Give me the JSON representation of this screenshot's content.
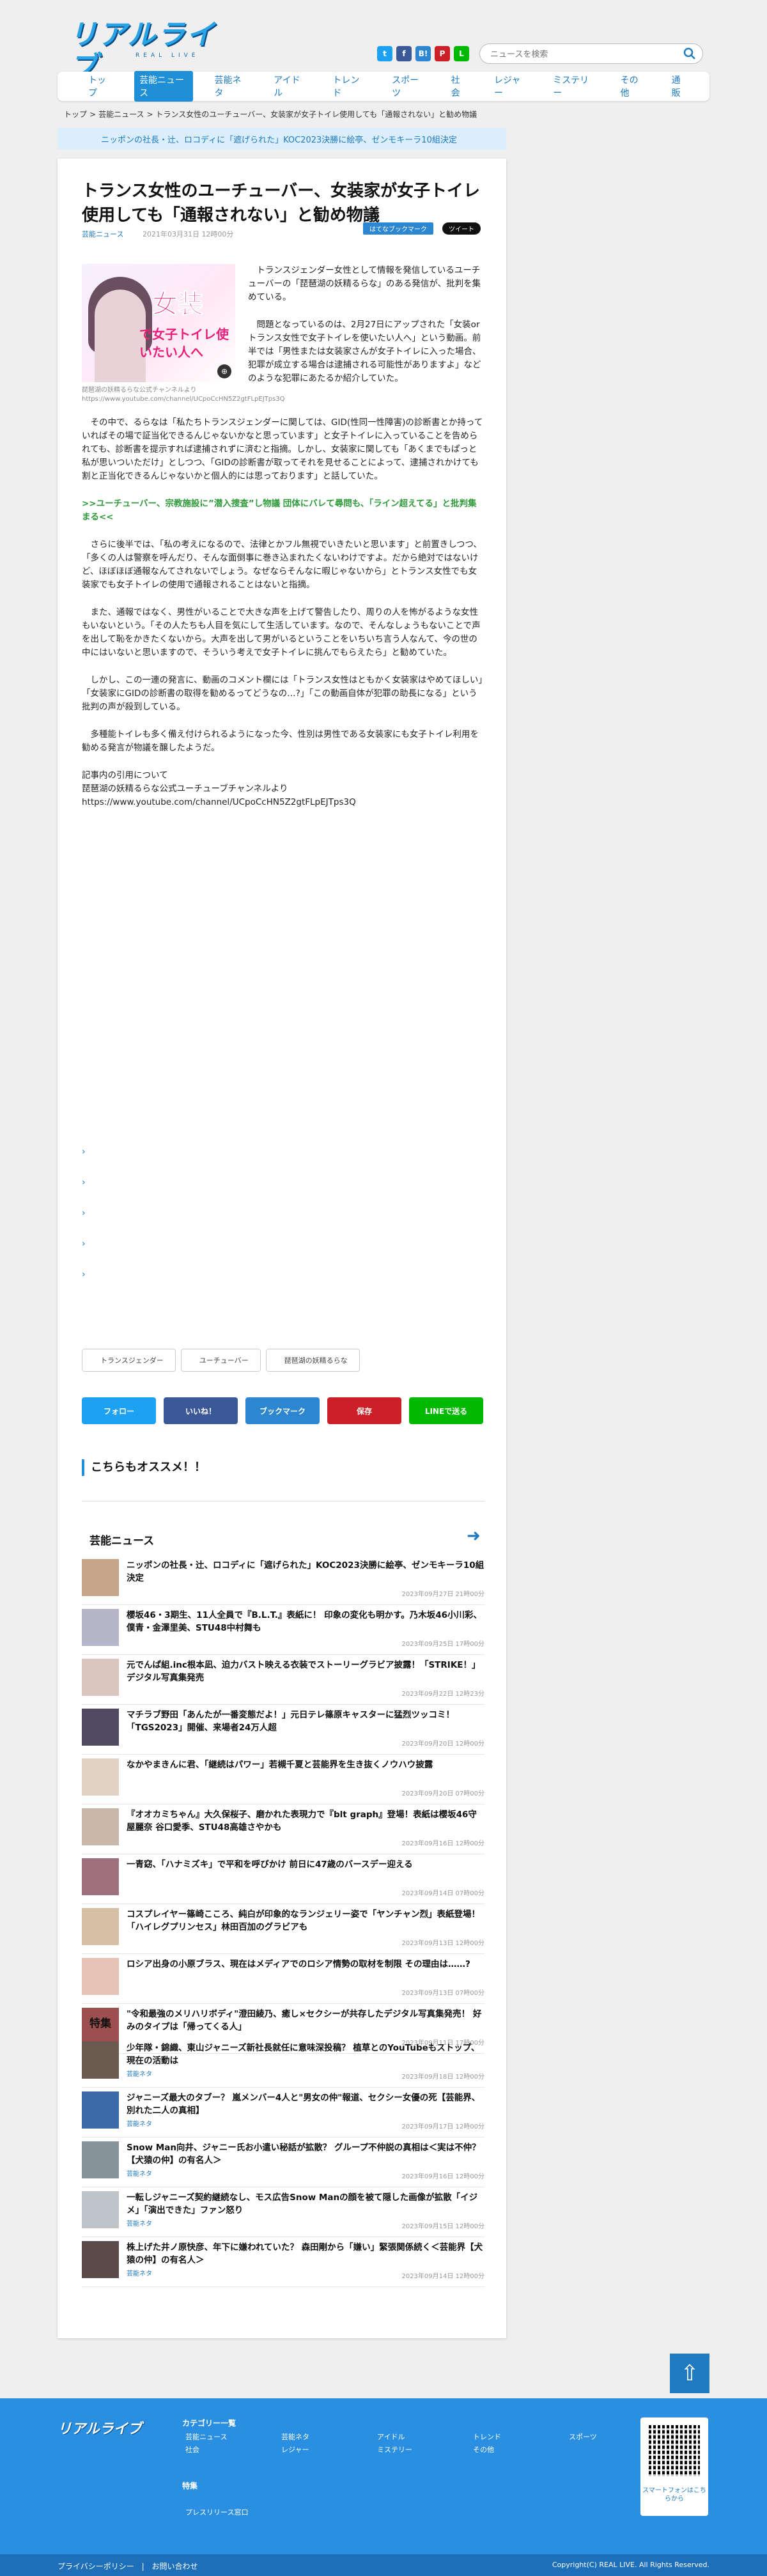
{
  "header": {
    "logo": "リアルライブ",
    "logo_sub": "REAL LIVE",
    "search_placeholder": "ニュースを検索",
    "sns": [
      {
        "icon": "twitter-icon",
        "glyph": "t",
        "color": "#1da1f2"
      },
      {
        "icon": "facebook-icon",
        "glyph": "f",
        "color": "#3b5998"
      },
      {
        "icon": "hatena-icon",
        "glyph": "B!",
        "color": "#2c87d0"
      },
      {
        "icon": "pinterest-icon",
        "glyph": "P",
        "color": "#cb2027"
      },
      {
        "icon": "line-icon",
        "glyph": "L",
        "color": "#00b900"
      }
    ]
  },
  "nav": [
    "トップ",
    "芸能ニュース",
    "芸能ネタ",
    "アイドル",
    "トレンド",
    "スポーツ",
    "社会",
    "レジャー",
    "ミステリー",
    "その他",
    "通販"
  ],
  "nav_active": "芸能ニュース",
  "breadcrumb": [
    "トップ",
    "芸能ニュース",
    "トランス女性のユーチューバー、女装家が女子トイレ使用しても「通報されない」と勧め物議"
  ],
  "promo": "ニッポンの社長・辻、ロコディに「遮げられた」KOC2023決勝に絵亭、ゼンモキーラ10組決定",
  "article": {
    "title": "トランス女性のユーチューバー、女装家が女子トイレ使用しても「通報されない」と勧め物議",
    "category": "芸能ニュース",
    "date": "2021年03月31日 12時00分",
    "btn_hatena": "はてなブックマーク",
    "btn_tweet": "ツイート",
    "thumb_text1": "女装",
    "thumb_text2": "で女子トイレ使いたい人へ",
    "caption": "琵琶湖の妖精るらな公式チャンネルより https://www.youtube.com/channel/UCpoCcHN5Z2gtFLpEJTps3Q",
    "paragraphs": [
      "トランスジェンダー女性として情報を発信しているユーチューバーの「琵琶湖の妖精るらな」のある発信が、批判を集めている。",
      "問題となっているのは、2月27日にアップされた「女装orトランス女性で女子トイレを使いたい人へ」という動画。前半では「男性または女装家さんが女子トイレに入った場合、犯罪が成立する場合は逮捕される可能性がありますよ」などのような犯罪にあたるか紹介していた。",
      "その中で、るらなは「私たちトランスジェンダーに関しては、GID(性同一性障害)の診断書とか持っていればその場で証当化できるんじゃないかなと思っています」と女子トイレに入っていることを告められても、診断書を提示すれば逮捕されずに済むと指摘。しかし、女装家に関しても「あくまでもぱっと私が思いついただけ」としつつ、「GIDの診断書が取ってそれを見せることによって、逮捕されかけても割と正当化できるんじゃないかと個人的には思っております」と話していた。",
      "さらに後半では、「私の考えになるので、法律とかフル無視でいきたいと思います」と前置きしつつ、「多くの人は警察を呼んだり、そんな面倒事に巻き込まれたくないわけですよ。だから絶対ではないけど、ほぼほぼ通報なんてされないでしょう。なぜならそんなに暇じゃないから」とトランス女性でも女装家でも女子トイレの使用で通報されることはないと指摘。",
      "また、通報ではなく、男性がいることで大きな声を上げて警告したり、周りの人を怖がるような女性もいないという。「その人たちも人目を気にして生活しています。なので、そんなしょうもないことで声を出して恥をかきたくないから。大声を出して男がいるということをいちいち言う人なんて、今の世の中にはいないと思いますので、そういう考えで女子トイレに挑んでもらえたら」と勧めていた。",
      "しかし、この一連の発言に、動画のコメント欄には「トランス女性はともかく女装家はやめてほしい」「女装家にGIDの診断書の取得を勧めるってどうなの…?」「この動画自体が犯罪の助長になる」という批判の声が殺到している。",
      "多種能トイレも多く備え付けられるようになった今、性別は男性である女装家にも女子トイレ利用を勧める発言が物議を醸したようだ。"
    ],
    "related_link": ">>ユーチューバー、宗教施設に”潜入捜査”し物議 団体にバレて尋問も、「ライン超えてる」と批判集まる<<",
    "source_label": "記事内の引用について",
    "source_name": "琵琶湖の妖精るらな公式ユーチューブチャンネルより",
    "source_url": "https://www.youtube.com/channel/UCpoCcHN5Z2gtFLpEJTps3Q",
    "arrow_links": [
      "›",
      "›",
      "›",
      "›",
      "›"
    ],
    "tags": [
      "トランスジェンダー",
      "ユーチューバー",
      "琵琶湖の妖精るらな"
    ],
    "share": [
      {
        "label": "フォロー",
        "color": "#1da1f2",
        "icon": "twitter-icon"
      },
      {
        "label": "いいね！",
        "color": "#3b5998",
        "icon": "facebook-icon"
      },
      {
        "label": "ブックマーク",
        "color": "#2c87d0",
        "icon": "hatena-icon"
      },
      {
        "label": "保存",
        "color": "#cb2027",
        "icon": "pinterest-icon"
      },
      {
        "label": "LINEで送る",
        "color": "#00b900",
        "icon": "line-icon"
      }
    ]
  },
  "recommend_title": "こちらもオススメ！！",
  "news_section": {
    "title": "芸能ニュース",
    "items": [
      {
        "title": "ニッポンの社長・辻、ロコディに「遮げられた」KOC2023決勝に絵亭、ゼンモキーラ10組決定",
        "date": "2023年09月27日 21時00分"
      },
      {
        "title": "櫻坂46・3期生、11人全員で『B.L.T.』表紙に！ 印象の変化も明かす。乃木坂46小川彩、僕青・金澤里美、STU48中村舞も",
        "date": "2023年09月25日 17時00分"
      },
      {
        "title": "元でんぱ組.inc根本凪、迫力バスト映える衣装でストーリーグラビア披露！「STRIKE！」デジタル写真集発売",
        "date": "2023年09月22日 12時23分"
      },
      {
        "title": "マチラブ野田「あんたが一番変態だよ！」元日テレ篠原キャスターに猛烈ツッコミ！「TGS2023」開催、来場者24万人超",
        "date": "2023年09月20日 12時00分"
      },
      {
        "title": "なかやまきんに君、「継続はパワー」若槻千夏と芸能界を生き抜くノウハウ披露",
        "date": "2023年09月20日 07時00分"
      },
      {
        "title": "『オオカミちゃん』大久保桜子、磨かれた表現力で『blt graph』登場！表紙は櫻坂46守屋麗奈 谷口愛季、STU48高雄さやかも",
        "date": "2023年09月16日 12時00分"
      },
      {
        "title": "一青窈、「ハナミズキ」で平和を呼びかけ 前日に47歳のバースデー迎える",
        "date": "2023年09月14日 07時00分"
      },
      {
        "title": "コスプレイヤー篠崎こころ、純白が印象的なランジェリー姿で「ヤンチャン烈」表紙登場！「ハイレグプリンセス」林田百加のグラビアも",
        "date": "2023年09月13日 12時00分"
      },
      {
        "title": "ロシア出身の小原ブラス、現在はメディアでのロシア情勢の取材を制限 その理由は……?",
        "date": "2023年09月13日 07時00分"
      },
      {
        "title": "\"令和最強のメリハリボディ\"澄田綾乃、癒し×セクシーが共存したデジタル写真集発売！ 好みのタイプは「帰ってくる人」",
        "date": "2023年09月11日 17時00分"
      }
    ]
  },
  "feature_section": {
    "title": "特集",
    "items": [
      {
        "title": "少年隊・錦織、東山ジャニーズ新社長就任に意味深投稿？ 植草とのYouTubeもストップ、現在の活動は",
        "category": "芸能ネタ",
        "date": "2023年09月18日 12時00分"
      },
      {
        "title": "ジャニーズ最大のタブー？ 嵐メンバー4人と\"男女の仲\"報道、セクシー女優の死【芸能界、別れた二人の真相】",
        "category": "芸能ネタ",
        "date": "2023年09月17日 12時00分"
      },
      {
        "title": "Snow Man向井、ジャニー氏お小遣い秘話が拡散？ グループ不仲説の真相は＜実は不仲？【犬猿の仲】の有名人＞",
        "category": "芸能ネタ",
        "date": "2023年09月16日 12時00分"
      },
      {
        "title": "一転しジャニーズ契約継続なし、モス広告Snow Manの顔を被て隠した画像が拡散「イジメ」「演出できた」ファン怒り",
        "category": "芸能ネタ",
        "date": "2023年09月15日 12時00分"
      },
      {
        "title": "株上げた井ノ原快彦、年下に嫌われていた？ 森田剛から「嫌い」緊張関係続く＜芸能界【犬猿の仲】の有名人＞",
        "category": "芸能ネタ",
        "date": "2023年09月14日 12時00分"
      }
    ]
  },
  "footer": {
    "logo": "リアルライブ",
    "category_head": "カテゴリー一覧",
    "categories": [
      "芸能ニュース",
      "芸能ネタ",
      "アイドル",
      "トレンド",
      "スポーツ",
      "社会",
      "レジャー",
      "ミステリー",
      "その他"
    ],
    "special_head": "特集",
    "press": "プレスリリース窓口",
    "qr_text": "スマートフォンはこちらから",
    "privacy": "プライバシーポリシー",
    "contact": "お問い合わせ",
    "copyright": "Copyright(C) REAL LIVE. All Rights Reserved."
  },
  "colors": {
    "brand": "#1f7ac0",
    "accent_bg": "#dbeefc",
    "footer": "#2a8fe0"
  }
}
